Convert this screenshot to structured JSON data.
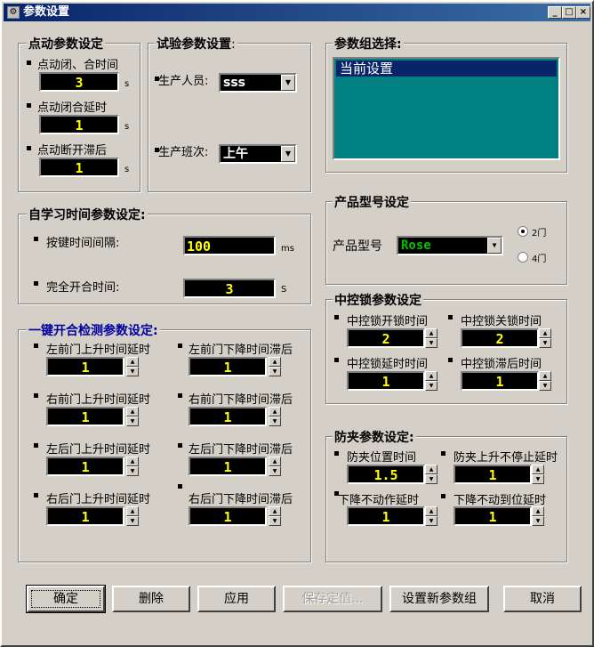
{
  "window": {
    "title": "参数设置",
    "minimize": "_",
    "maximize": "□",
    "close": "×"
  },
  "jog": {
    "title": "点动参数设定",
    "items": [
      {
        "label": "点动闭、合时间",
        "value": "3",
        "unit": "s"
      },
      {
        "label": "点动闭合延时",
        "value": "1",
        "unit": "s"
      },
      {
        "label": "点动断开滞后",
        "value": "1",
        "unit": "s"
      }
    ]
  },
  "test": {
    "title": "试验参数设置",
    "title_suffix": ":",
    "operator_label": "生产人员:",
    "operator_value": "sss",
    "shift_label": "生产班次:",
    "shift_value": "上午"
  },
  "group": {
    "title": "参数组选择:",
    "items": [
      "当前设置"
    ]
  },
  "selflearn": {
    "title": "自学习时间参数设定:",
    "key_label": "按键时间间隔:",
    "key_value": "100",
    "key_unit": "ms",
    "open_label": "完全开合时间:",
    "open_value": "3",
    "open_unit": "S"
  },
  "product": {
    "title": "产品型号设定",
    "model_label": "产品型号",
    "model_value": "Rose",
    "radio_2": "2门",
    "radio_4": "4门"
  },
  "lock": {
    "title": "中控锁参数设定",
    "items": [
      {
        "label": "中控锁开锁时间",
        "value": "2"
      },
      {
        "label": "中控锁关锁时间",
        "value": "2"
      },
      {
        "label": "中控锁延时时间",
        "value": "1"
      },
      {
        "label": "中控锁滞后时间",
        "value": "1"
      }
    ]
  },
  "onekey": {
    "title": "一键开合检测参数设定:",
    "items": [
      {
        "label": "左前门上升时间延时",
        "value": "1"
      },
      {
        "label": "左前门下降时间滞后",
        "value": "1"
      },
      {
        "label": "右前门上升时间延时",
        "value": "1"
      },
      {
        "label": "右前门下降时间滞后",
        "value": "1"
      },
      {
        "label": "左后门上升时间延时",
        "value": "1"
      },
      {
        "label": "左后门下降时间滞后",
        "value": "1"
      },
      {
        "label": "右后门上升时间延时",
        "value": "1"
      },
      {
        "label": "右后门下降时间滞后",
        "value": "1"
      }
    ]
  },
  "pinch": {
    "title": "防夹参数设定:",
    "items": [
      {
        "label": "防夹位置时间",
        "value": "1.5"
      },
      {
        "label": "防夹上升不停止延时",
        "value": "1"
      },
      {
        "label": "下降不动作延时",
        "value": "1"
      },
      {
        "label": "下降不动到位延时",
        "value": "1"
      }
    ]
  },
  "buttons": {
    "ok": "确定",
    "delete": "删除",
    "apply": "应用",
    "save": "保存定值...",
    "newgroup": "设置新参数组",
    "cancel": "取消"
  }
}
